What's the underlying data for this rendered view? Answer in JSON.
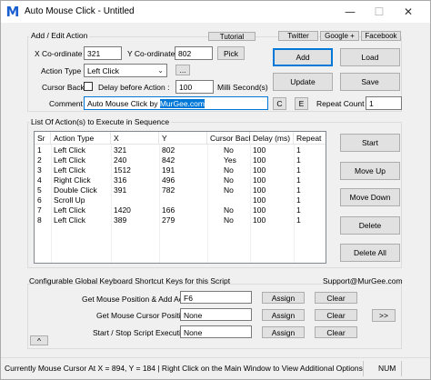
{
  "window": {
    "title": "Auto Mouse Click - Untitled",
    "app_icon_letter": "M",
    "minimize_glyph": "—",
    "maximize_glyph": "☐",
    "close_glyph": "✕"
  },
  "top_links": {
    "tutorial": "Tutorial",
    "twitter": "Twitter",
    "google": "Google +",
    "facebook": "Facebook"
  },
  "add_edit": {
    "group_title": "Add / Edit Action",
    "x_label": "X Co-ordinate :",
    "x_value": "321",
    "y_label": "Y Co-ordinate :",
    "y_value": "802",
    "pick_label": "Pick",
    "action_type_label": "Action Type :",
    "action_type_value": "Left Click",
    "more_label": "...",
    "cursor_back_label": "Cursor Back :",
    "cursor_back_checked": false,
    "delay_label": "Delay before Action :",
    "delay_value": "100",
    "delay_unit": "Milli Second(s)",
    "comment_label": "Comment :",
    "comment_prefix": "Auto Mouse Click by ",
    "comment_selected": "MurGee.com",
    "c_label": "C",
    "e_label": "E",
    "add_label": "Add",
    "load_label": "Load",
    "update_label": "Update",
    "save_label": "Save",
    "repeat_count_label": "Repeat Count :",
    "repeat_count_value": "1"
  },
  "actions": {
    "group_title": "List Of Action(s) to Execute in Sequence",
    "columns": [
      "Sr",
      "Action Type",
      "X",
      "Y",
      "Cursor Back",
      "Delay (ms)",
      "Repeat"
    ],
    "rows": [
      {
        "sr": "1",
        "type": "Left Click",
        "x": "321",
        "y": "802",
        "cursor": "No",
        "delay": "100",
        "repeat": "1"
      },
      {
        "sr": "2",
        "type": "Left Click",
        "x": "240",
        "y": "842",
        "cursor": "Yes",
        "delay": "100",
        "repeat": "1"
      },
      {
        "sr": "3",
        "type": "Left Click",
        "x": "1512",
        "y": "191",
        "cursor": "No",
        "delay": "100",
        "repeat": "1"
      },
      {
        "sr": "4",
        "type": "Right Click",
        "x": "316",
        "y": "496",
        "cursor": "No",
        "delay": "100",
        "repeat": "1"
      },
      {
        "sr": "5",
        "type": "Double Click",
        "x": "391",
        "y": "782",
        "cursor": "No",
        "delay": "100",
        "repeat": "1"
      },
      {
        "sr": "6",
        "type": "Scroll Up",
        "x": "",
        "y": "",
        "cursor": "",
        "delay": "100",
        "repeat": "1"
      },
      {
        "sr": "7",
        "type": "Left Click",
        "x": "1420",
        "y": "166",
        "cursor": "No",
        "delay": "100",
        "repeat": "1"
      },
      {
        "sr": "8",
        "type": "Left Click",
        "x": "389",
        "y": "279",
        "cursor": "No",
        "delay": "100",
        "repeat": "1"
      }
    ],
    "start_label": "Start",
    "move_up_label": "Move Up",
    "move_down_label": "Move Down",
    "delete_label": "Delete",
    "delete_all_label": "Delete All"
  },
  "shortcuts": {
    "group_title": "Configurable Global Keyboard Shortcut Keys for this Script",
    "support": "Support@MurGee.com",
    "rows": [
      {
        "label": "Get Mouse Position & Add Action :",
        "value": "F6",
        "assign": "Assign",
        "clear": "Clear"
      },
      {
        "label": "Get Mouse Cursor Position :",
        "value": "None",
        "assign": "Assign",
        "clear": "Clear"
      },
      {
        "label": "Start / Stop Script Execution :",
        "value": "None",
        "assign": "Assign",
        "clear": "Clear"
      }
    ],
    "more_label": ">>",
    "collapse_label": "^"
  },
  "status": {
    "text": "Currently Mouse Cursor At X = 894, Y = 184 | Right Click on the Main Window to View Additional Options",
    "num": "NUM"
  }
}
